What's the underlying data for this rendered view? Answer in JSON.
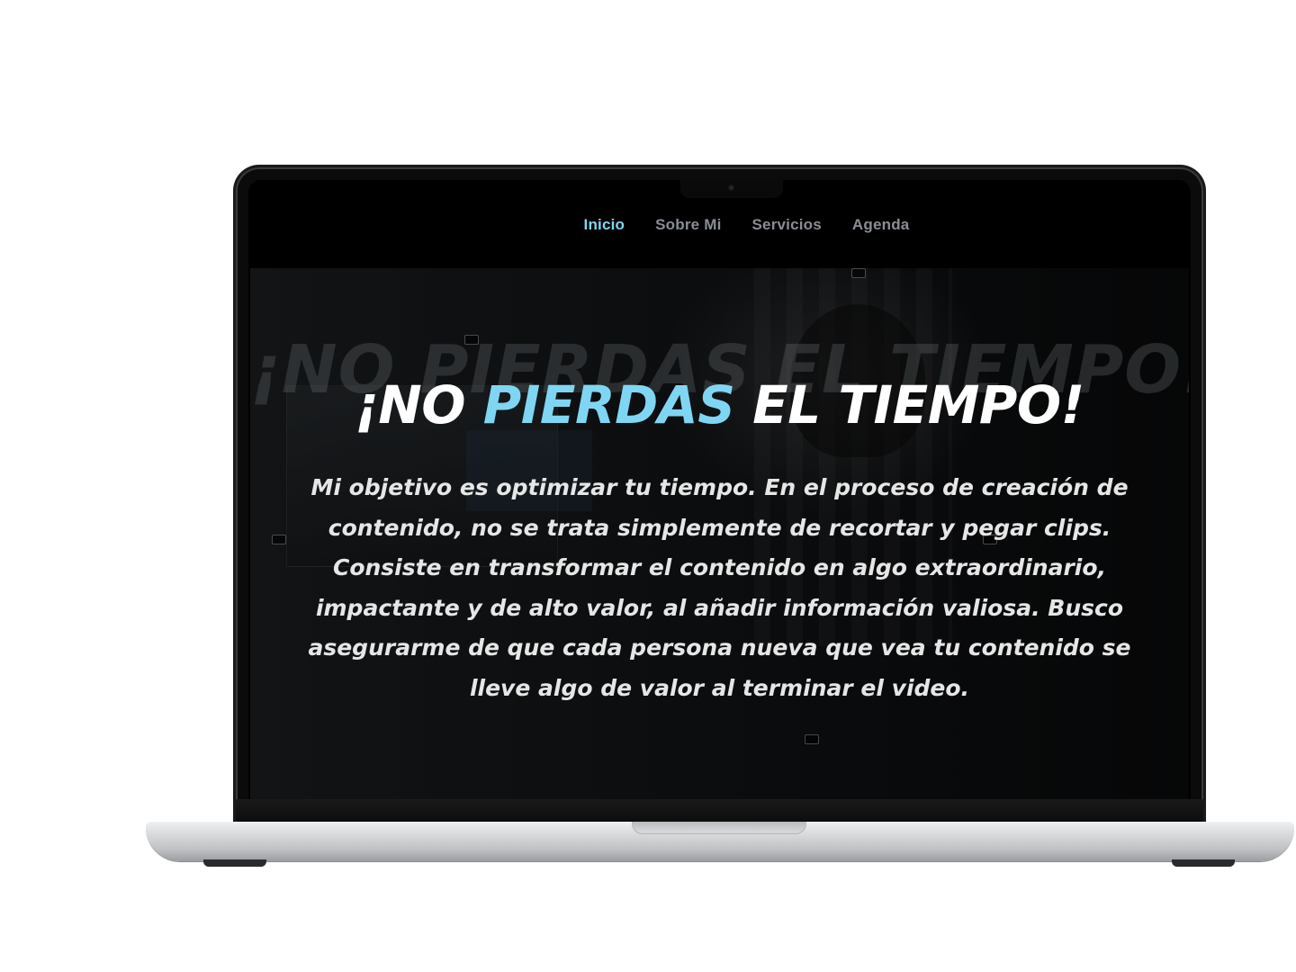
{
  "nav": {
    "items": [
      {
        "label": "Inicio",
        "active": true
      },
      {
        "label": "Sobre Mi",
        "active": false
      },
      {
        "label": "Servicios",
        "active": false
      },
      {
        "label": "Agenda",
        "active": false
      }
    ]
  },
  "hero": {
    "ghost_title": "¡NO PIERDAS EL TIEMPO!",
    "title_part1": "¡NO ",
    "title_accent": "PIERDAS",
    "title_part2": " EL TIEMPO!",
    "body": "Mi objetivo es optimizar tu tiempo. En el proceso de creación de contenido, no se trata simplemente de recortar y pegar clips. Consiste en transformar el contenido en algo extraordinario, impactante y de alto valor, al añadir información valiosa. Busco asegurarme de que cada persona nueva que vea tu contenido se lleve algo de valor al terminar el video."
  },
  "colors": {
    "accent": "#7fd6f2",
    "nav_inactive": "#8a8d96",
    "background": "#000000",
    "text": "#ffffff"
  }
}
